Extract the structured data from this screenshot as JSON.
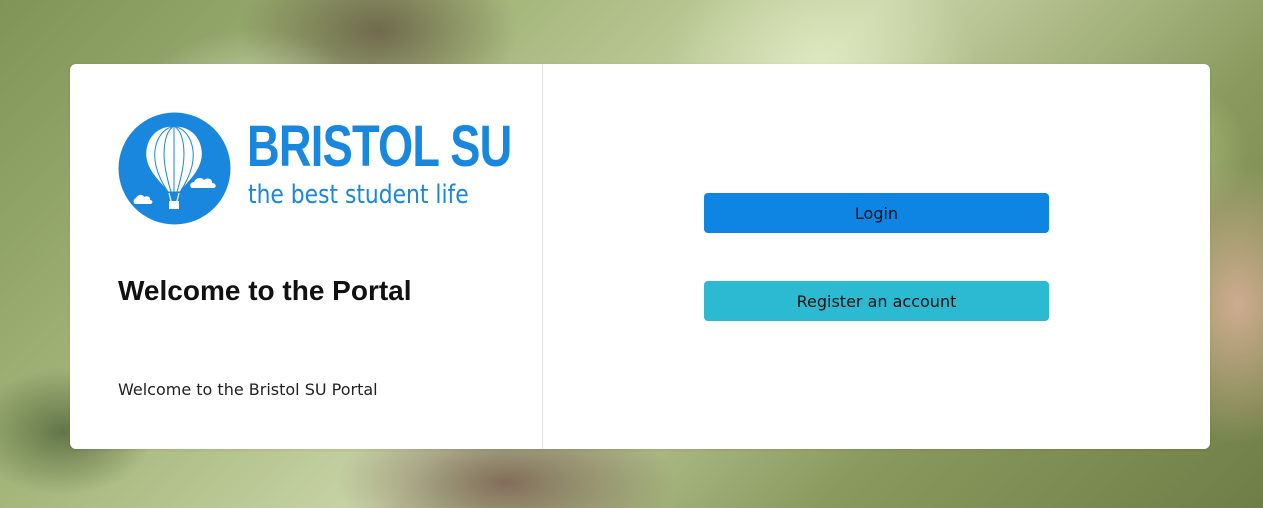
{
  "logo": {
    "name": "BRISTOL SU",
    "tagline": "the best student life",
    "brand_color": "#1a87de",
    "icon": "hot-air-balloon-icon"
  },
  "main": {
    "title": "Welcome to the Portal",
    "description": "Welcome to the Bristol SU Portal"
  },
  "actions": {
    "login_label": "Login",
    "login_color": "#0e85e3",
    "register_label": "Register an account",
    "register_color": "#2bbad1"
  }
}
